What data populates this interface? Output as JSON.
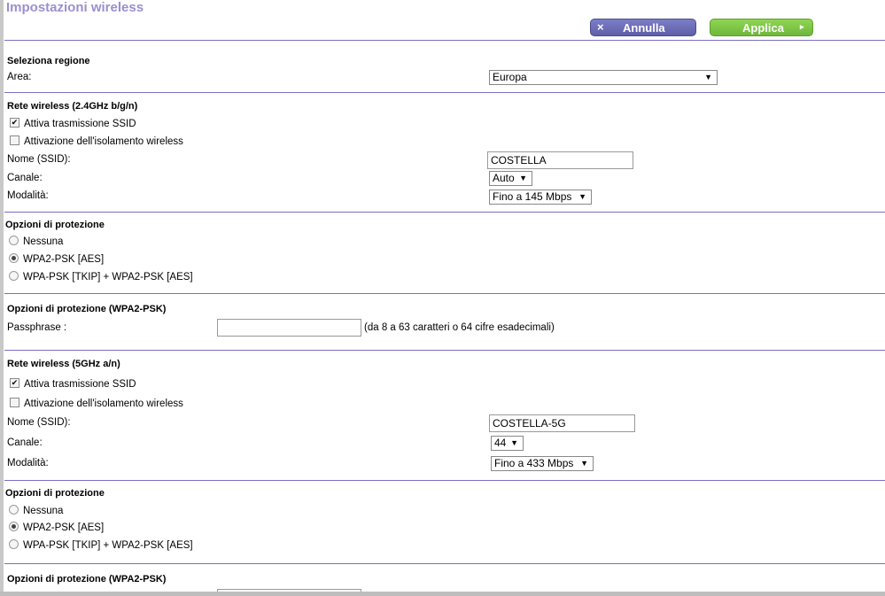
{
  "page": {
    "title": "Impostazioni wireless"
  },
  "toolbar": {
    "cancel_label": "Annulla",
    "apply_label": "Applica",
    "cancel_icon": "×",
    "apply_icon": "▸"
  },
  "region": {
    "header": "Seleziona regione",
    "area_label": "Area:",
    "area_value": "Europa"
  },
  "wifi24": {
    "header": "Rete wireless (2.4GHz b/g/n)",
    "ssid_broadcast": "Attiva trasmissione SSID",
    "isolation": "Attivazione dell'isolamento wireless",
    "ssid_label": "Nome (SSID):",
    "ssid_value": "COSTELLA",
    "channel_label": "Canale:",
    "channel_value": "Auto",
    "mode_label": "Modalità:",
    "mode_value": "Fino a 145 Mbps"
  },
  "security24": {
    "header": "Opzioni di protezione",
    "opt_none": "Nessuna",
    "opt_wpa2": "WPA2-PSK [AES]",
    "opt_mixed": "WPA-PSK [TKIP] + WPA2-PSK [AES]"
  },
  "wpa24": {
    "header": "Opzioni di protezione (WPA2-PSK)",
    "pass_label": "Passphrase :",
    "pass_hint": "(da 8 a 63 caratteri o 64 cifre esadecimali)"
  },
  "wifi5": {
    "header": "Rete wireless (5GHz a/n)",
    "ssid_broadcast": "Attiva trasmissione SSID",
    "isolation": "Attivazione dell'isolamento wireless",
    "ssid_label": "Nome (SSID):",
    "ssid_value": "COSTELLA-5G",
    "channel_label": "Canale:",
    "channel_value": "44",
    "mode_label": "Modalità:",
    "mode_value": "Fino a 433 Mbps"
  },
  "security5": {
    "header": "Opzioni di protezione",
    "opt_none": "Nessuna",
    "opt_wpa2": "WPA2-PSK [AES]",
    "opt_mixed": "WPA-PSK [TKIP] + WPA2-PSK [AES]"
  },
  "wpa5": {
    "header": "Opzioni di protezione (WPA2-PSK)"
  },
  "colors": {
    "accent": "#7b6fc3",
    "title": "#9b8fd1",
    "apply": "#7fc748",
    "cancel": "#6a6bb5"
  }
}
